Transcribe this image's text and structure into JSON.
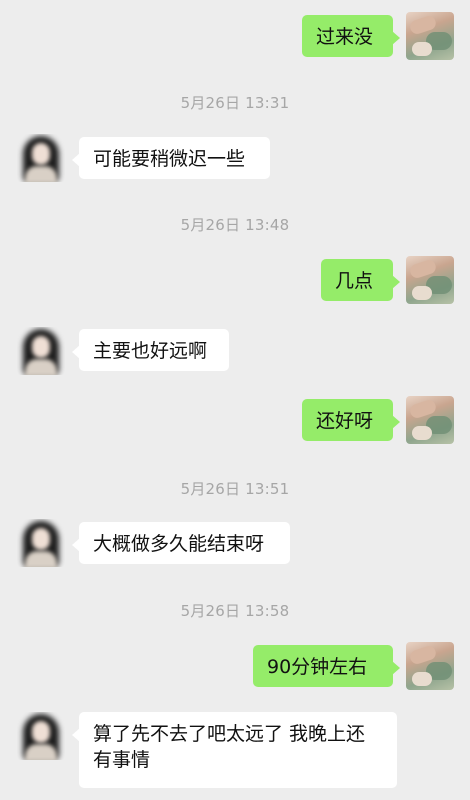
{
  "messages": [
    {
      "type": "out",
      "text": "过来没"
    },
    {
      "type": "timestamp",
      "text": "5月26日 13:31"
    },
    {
      "type": "in",
      "text": "可能要稍微迟一些"
    },
    {
      "type": "timestamp",
      "text": "5月26日 13:48"
    },
    {
      "type": "out",
      "text": "几点"
    },
    {
      "type": "in",
      "text": "主要也好远啊"
    },
    {
      "type": "out",
      "text": "还好呀"
    },
    {
      "type": "timestamp",
      "text": "5月26日 13:51"
    },
    {
      "type": "in",
      "text": "大概做多久能结束呀"
    },
    {
      "type": "timestamp",
      "text": "5月26日 13:58"
    },
    {
      "type": "out",
      "text": "90分钟左右"
    },
    {
      "type": "in",
      "lines": [
        "算了先不去了吧太远了 我晚上还",
        "有事情"
      ]
    }
  ],
  "colors": {
    "background": "#ededed",
    "incoming_bubble": "#ffffff",
    "outgoing_bubble": "#95ec69",
    "timestamp_text": "#a6a6a6"
  },
  "icons": {
    "contact_avatar": "blurred-girl-avatar-icon",
    "self_avatar": "spa-photo-avatar-icon"
  }
}
